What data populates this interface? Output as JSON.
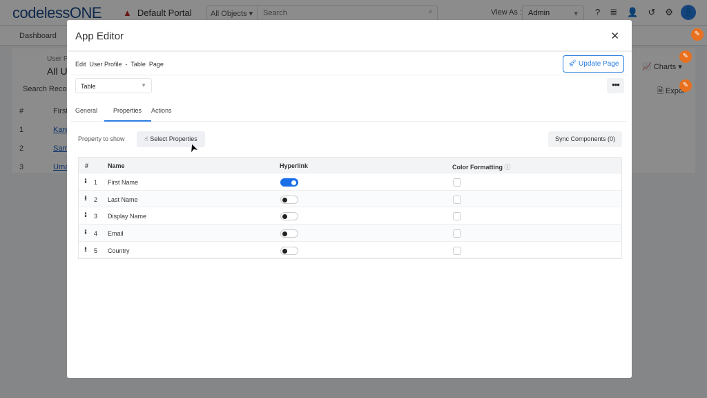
{
  "topbar": {
    "logo": "codelessONE",
    "portal": "Default Portal",
    "object_select": "All Objects",
    "search_placeholder": "Search",
    "view_as_label": "View As :",
    "view_as_value": "Admin"
  },
  "nav": {
    "dashboard": "Dashboard"
  },
  "background": {
    "object_label": "User P",
    "object_title": "All U",
    "search_records": "Search Record",
    "col_hash": "#",
    "col_first": "First",
    "rows": [
      {
        "n": "1",
        "link": "Kare"
      },
      {
        "n": "2",
        "link": "Sam"
      },
      {
        "n": "3",
        "link": "Uma"
      }
    ],
    "charts": "Charts",
    "export": "Expor"
  },
  "modal": {
    "title": "App Editor",
    "breadcrumb": "Edit  User Profile  -  Table  Page",
    "update_button": "Update Page",
    "component_select": "Table",
    "tabs": [
      "General",
      "Properties",
      "Actions"
    ],
    "active_tab": "Properties",
    "property_to_show": "Property to show",
    "select_properties": "Select Properties",
    "sync_components": "Sync Components (0)",
    "table": {
      "headers": [
        "#",
        "Name",
        "Hyperlink",
        "Color Formatting"
      ],
      "rows": [
        {
          "n": "1",
          "name": "First Name",
          "hyperlink": true,
          "color_formatting": false
        },
        {
          "n": "2",
          "name": "Last Name",
          "hyperlink": false,
          "color_formatting": false
        },
        {
          "n": "3",
          "name": "Display Name",
          "hyperlink": false,
          "color_formatting": false
        },
        {
          "n": "4",
          "name": "Email",
          "hyperlink": false,
          "color_formatting": false
        },
        {
          "n": "5",
          "name": "Country",
          "hyperlink": false,
          "color_formatting": false
        }
      ]
    }
  },
  "colors": {
    "accent": "#2a7de1",
    "toggle_on": "#1a6fe8",
    "edit_badge": "#e8701e"
  }
}
